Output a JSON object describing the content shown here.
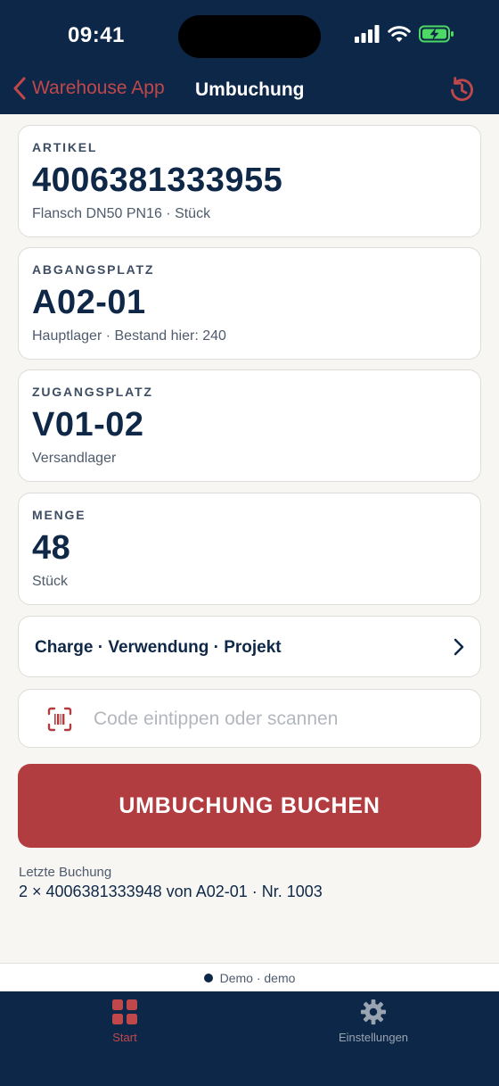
{
  "status_bar": {
    "time": "09:41"
  },
  "nav": {
    "back_label": "Warehouse App",
    "title": "Umbuchung"
  },
  "fields": {
    "artikel": {
      "label": "ARTIKEL",
      "value": "4006381333955",
      "sub": "Flansch DN50 PN16 · Stück"
    },
    "abgangsplatz": {
      "label": "ABGANGSPLATZ",
      "value": "A02-01",
      "sub": "Hauptlager · Bestand hier: 240"
    },
    "zugangsplatz": {
      "label": "ZUGANGSPLATZ",
      "value": "V01-02",
      "sub": "Versandlager"
    },
    "menge": {
      "label": "MENGE",
      "value": "48",
      "sub": "Stück"
    }
  },
  "details_row": {
    "label": "Charge · Verwendung · Projekt"
  },
  "scan": {
    "placeholder": "Code eintippen oder scannen",
    "value": ""
  },
  "book_button": {
    "label": "UMBUCHUNG BUCHEN"
  },
  "last_booking": {
    "label": "Letzte Buchung",
    "value": "2 × 4006381333948 von A02-01 · Nr. 1003"
  },
  "environment": {
    "label": "Demo · demo"
  },
  "tabs": [
    {
      "label": "Start",
      "icon": "grid-icon",
      "active": true
    },
    {
      "label": "Einstellungen",
      "icon": "gear-icon",
      "active": false
    }
  ],
  "colors": {
    "navy": "#0d2748",
    "accent_red": "#b23d40",
    "background": "#f7f6f3",
    "battery_green": "#4cd964"
  }
}
